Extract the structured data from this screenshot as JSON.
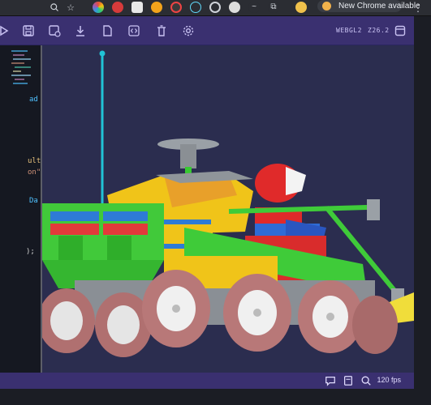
{
  "browser": {
    "update_label": "New Chrome available",
    "search_icon": "magnifier-icon",
    "star_icon": "star-icon"
  },
  "toolbar": {
    "webgl_label": "WEBGL2",
    "version_label": "Z26.2"
  },
  "code_lines": [
    {
      "text": "ad",
      "color": "#4fc1ff"
    },
    {
      "text": "ult",
      "color": "#e5c07b"
    },
    {
      "text": "on\"",
      "color": "#ce9178"
    },
    {
      "text": "Da",
      "color": "#4fc1ff"
    },
    {
      "text": ");",
      "color": "#d4d4d4"
    }
  ],
  "status": {
    "fps_label": "120 fps"
  },
  "colors": {
    "toolbar_bg": "#3a3070",
    "viewport_bg": "#2b2d4f",
    "accent": "#c9c2f2"
  }
}
